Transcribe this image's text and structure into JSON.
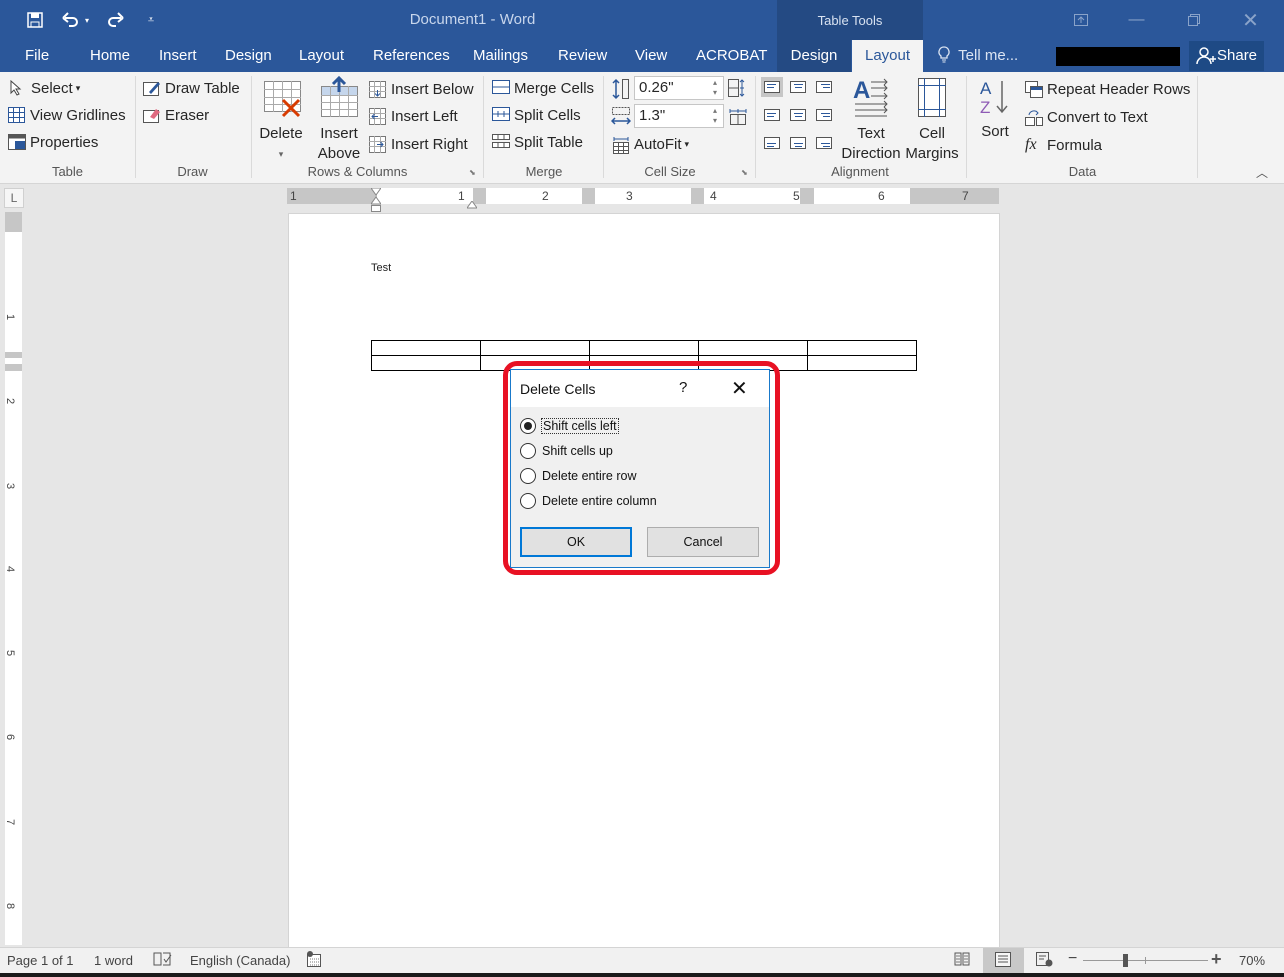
{
  "window": {
    "title": "Document1 - Word",
    "context_header": "Table Tools",
    "qat": {
      "save_icon": "save-icon",
      "undo_icon": "undo-icon",
      "redo_icon": "redo-icon",
      "customize_icon": "customize-qat-icon"
    },
    "controls": {
      "ribbon_display": "ribbon-display-options-icon",
      "minimize": "minimize-icon",
      "restore": "restore-icon",
      "close": "close-icon"
    }
  },
  "tabs": [
    {
      "label": "File"
    },
    {
      "label": "Home"
    },
    {
      "label": "Insert"
    },
    {
      "label": "Design"
    },
    {
      "label": "Layout"
    },
    {
      "label": "References"
    },
    {
      "label": "Mailings"
    },
    {
      "label": "Review"
    },
    {
      "label": "View"
    },
    {
      "label": "ACROBAT"
    },
    {
      "label": "Design",
      "contextual": true
    },
    {
      "label": "Layout",
      "contextual": true,
      "active": true
    }
  ],
  "tell_me": "Tell me...",
  "share": "Share",
  "ribbon": {
    "table": {
      "label": "Table",
      "select": "Select",
      "view_gridlines": "View Gridlines",
      "properties": "Properties"
    },
    "draw": {
      "label": "Draw",
      "draw_table": "Draw Table",
      "eraser": "Eraser"
    },
    "rows_columns": {
      "label": "Rows & Columns",
      "delete": "Delete",
      "insert_above_1": "Insert",
      "insert_above_2": "Above",
      "insert_below": "Insert Below",
      "insert_left": "Insert Left",
      "insert_right": "Insert Right"
    },
    "merge": {
      "label": "Merge",
      "merge_cells": "Merge Cells",
      "split_cells": "Split Cells",
      "split_table": "Split Table"
    },
    "cell_size": {
      "label": "Cell Size",
      "height": "0.26\"",
      "width": "1.3\"",
      "autofit": "AutoFit"
    },
    "alignment": {
      "label": "Alignment",
      "text_direction_1": "Text",
      "text_direction_2": "Direction",
      "cell_margins_1": "Cell",
      "cell_margins_2": "Margins",
      "selected_alignment": "top-left"
    },
    "data": {
      "label": "Data",
      "sort": "Sort",
      "repeat_header_rows": "Repeat Header Rows",
      "convert_to_text": "Convert to Text",
      "formula": "Formula"
    }
  },
  "ruler": {
    "h_numbers": [
      "1",
      "1",
      "2",
      "3",
      "4",
      "5",
      "6",
      "7"
    ],
    "v_numbers": [
      "1",
      "2",
      "3",
      "4",
      "5",
      "6",
      "7",
      "8"
    ],
    "tab_selector": "L"
  },
  "document": {
    "text": "Test",
    "table": {
      "rows": 2,
      "cols": 5
    }
  },
  "dialog": {
    "title": "Delete Cells",
    "help": "?",
    "options": [
      {
        "label": "Shift cells left",
        "selected": true
      },
      {
        "label": "Shift cells up",
        "selected": false
      },
      {
        "label": "Delete entire row",
        "selected": false
      },
      {
        "label": "Delete entire column",
        "selected": false
      }
    ],
    "ok": "OK",
    "cancel": "Cancel",
    "highlight_color": "#e81123"
  },
  "status": {
    "page": "Page 1 of 1",
    "words": "1 word",
    "language": "English (Canada)",
    "zoom": "70%",
    "zoom_percent": 70
  },
  "colors": {
    "brand": "#2b579a",
    "context_tab": "#244a83",
    "dialog_border": "#1979ca"
  }
}
